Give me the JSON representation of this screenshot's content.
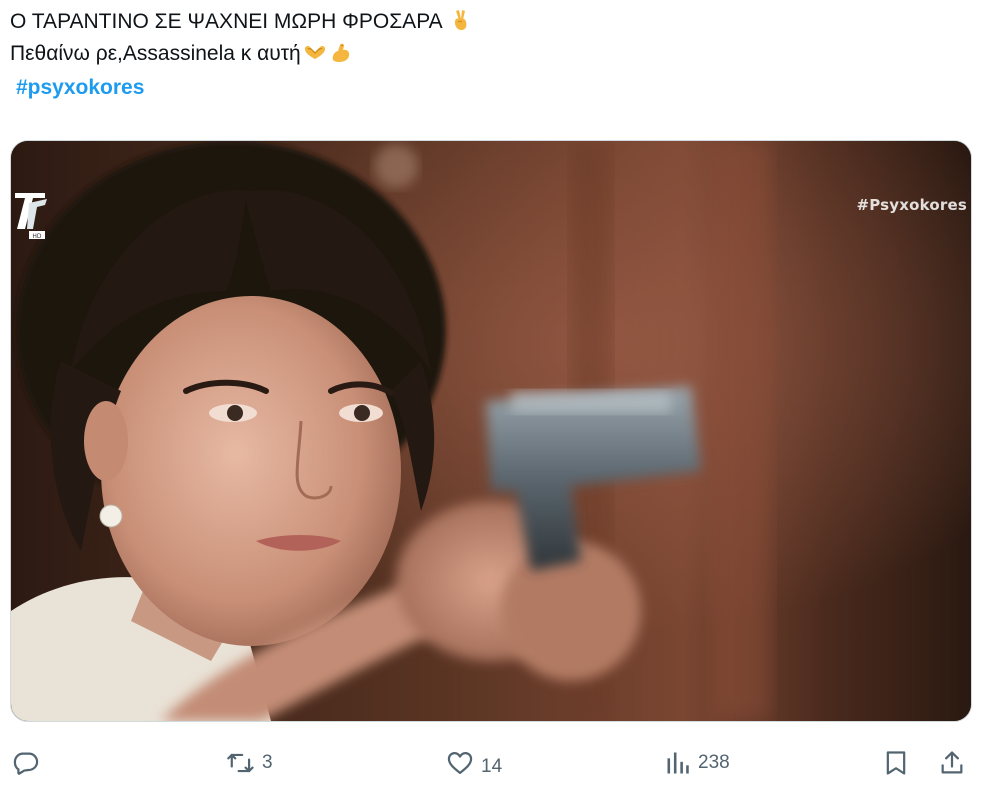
{
  "tweet": {
    "line1": "Ο ΤΑΡΑΝΤΙΝΟ ΣΕ ΨΑΧΝΕΙ ΜΩΡΗ ΦΡΟΣΑΡΑ",
    "line1_emoji": "victory-hand-emoji",
    "line2": "Πεθαίνω ρε,Assassinela κ αυτή",
    "line2_emojis": [
      "heart-hands-emoji",
      "flexed-biceps-emoji"
    ],
    "hashtag": "#psyxokores"
  },
  "media": {
    "channel_logo_icon": "ert-channel-logo",
    "watermark": "#Psyxokores",
    "description_icon": "woman-aiming-pistol-photo"
  },
  "actions": {
    "reply_icon": "reply-icon",
    "retweet_icon": "retweet-icon",
    "retweet_count": "3",
    "like_icon": "heart-icon",
    "like_count": "14",
    "views_icon": "analytics-icon",
    "views_count": "238",
    "bookmark_icon": "bookmark-icon",
    "share_icon": "share-icon"
  },
  "colors": {
    "hashtag": "#1d9bf0",
    "text": "#0f1419",
    "action_icon": "#536471"
  }
}
